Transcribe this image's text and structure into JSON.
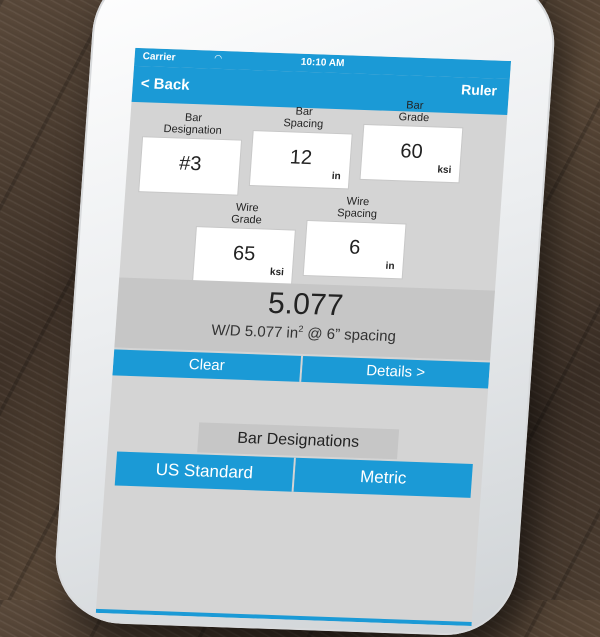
{
  "status": {
    "carrier": "Carrier",
    "time": "10:10 AM"
  },
  "nav": {
    "back_label": "< Back",
    "ruler_label": "Ruler"
  },
  "inputs": {
    "bar_designation": {
      "label_line1": "Bar",
      "label_line2": "Designation",
      "value": "#3",
      "unit": ""
    },
    "bar_spacing": {
      "label_line1": "Bar",
      "label_line2": "Spacing",
      "value": "12",
      "unit": "in"
    },
    "bar_grade": {
      "label_line1": "Bar",
      "label_line2": "Grade",
      "value": "60",
      "unit": "ksi"
    },
    "wire_grade": {
      "label_line1": "Wire",
      "label_line2": "Grade",
      "value": "65",
      "unit": "ksi"
    },
    "wire_spacing": {
      "label_line1": "Wire",
      "label_line2": "Spacing",
      "value": "6",
      "unit": "in"
    }
  },
  "result": {
    "value": "5.077",
    "desc_prefix": "W/D 5.077 in",
    "desc_sup": "2",
    "desc_suffix": " @ 6” spacing"
  },
  "actions": {
    "clear_label": "Clear",
    "details_label": "Details >"
  },
  "designations": {
    "title": "Bar Designations",
    "us_label": "US Standard",
    "metric_label": "Metric"
  },
  "colors": {
    "accent": "#1b9ad6",
    "panel": "#d4d4d4",
    "result_bg": "#c6c6c6"
  }
}
